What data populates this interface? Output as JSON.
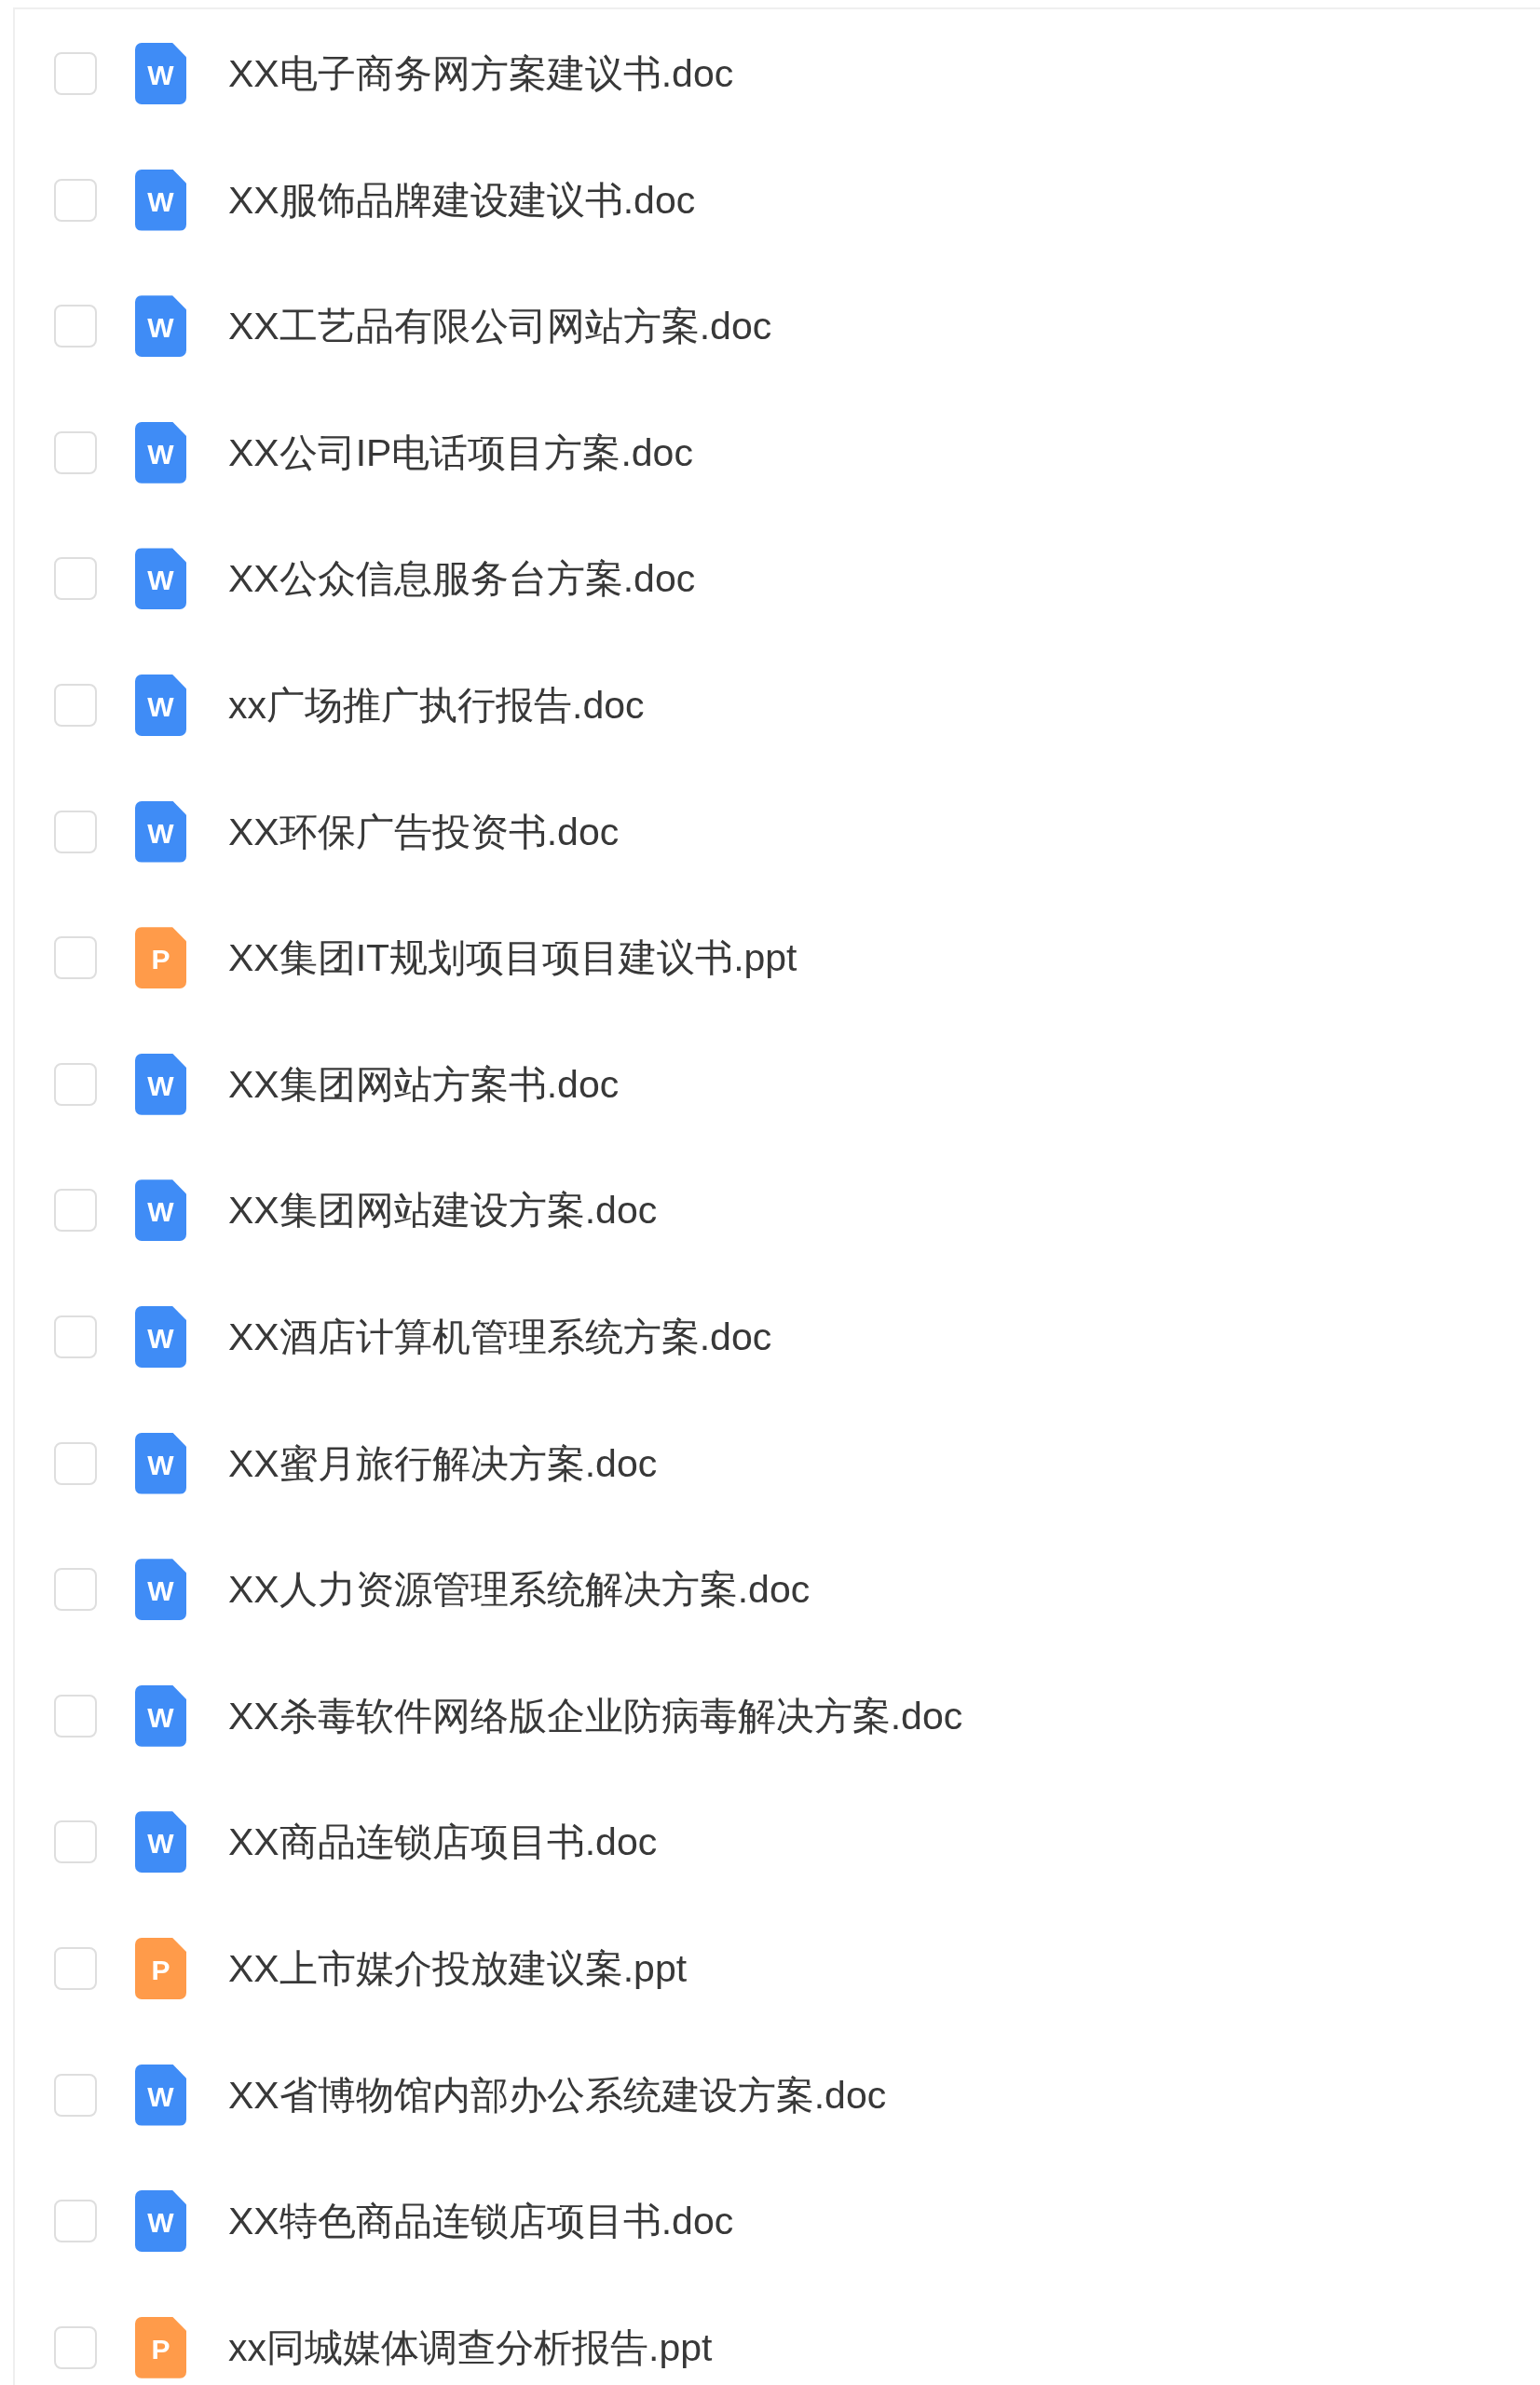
{
  "files": [
    {
      "name": "XX电子商务网方案建议书.doc",
      "kind": "word",
      "icon_label": "W",
      "checked": false
    },
    {
      "name": "XX服饰品牌建设建议书.doc",
      "kind": "word",
      "icon_label": "W",
      "checked": false
    },
    {
      "name": "XX工艺品有限公司网站方案.doc",
      "kind": "word",
      "icon_label": "W",
      "checked": false
    },
    {
      "name": "XX公司IP电话项目方案.doc",
      "kind": "word",
      "icon_label": "W",
      "checked": false
    },
    {
      "name": "XX公众信息服务台方案.doc",
      "kind": "word",
      "icon_label": "W",
      "checked": false
    },
    {
      "name": "xx广场推广执行报告.doc",
      "kind": "word",
      "icon_label": "W",
      "checked": false
    },
    {
      "name": "XX环保广告投资书.doc",
      "kind": "word",
      "icon_label": "W",
      "checked": false
    },
    {
      "name": "XX集团IT规划项目项目建议书.ppt",
      "kind": "powerpoint",
      "icon_label": "P",
      "checked": false
    },
    {
      "name": "XX集团网站方案书.doc",
      "kind": "word",
      "icon_label": "W",
      "checked": false
    },
    {
      "name": "XX集团网站建设方案.doc",
      "kind": "word",
      "icon_label": "W",
      "checked": false
    },
    {
      "name": "XX酒店计算机管理系统方案.doc",
      "kind": "word",
      "icon_label": "W",
      "checked": false
    },
    {
      "name": "XX蜜月旅行解决方案.doc",
      "kind": "word",
      "icon_label": "W",
      "checked": false
    },
    {
      "name": "XX人力资源管理系统解决方案.doc",
      "kind": "word",
      "icon_label": "W",
      "checked": false
    },
    {
      "name": "XX杀毒软件网络版企业防病毒解决方案.doc",
      "kind": "word",
      "icon_label": "W",
      "checked": false
    },
    {
      "name": "XX商品连锁店项目书.doc",
      "kind": "word",
      "icon_label": "W",
      "checked": false
    },
    {
      "name": "XX上市媒介投放建议案.ppt",
      "kind": "powerpoint",
      "icon_label": "P",
      "checked": false
    },
    {
      "name": "XX省博物馆内部办公系统建设方案.doc",
      "kind": "word",
      "icon_label": "W",
      "checked": false
    },
    {
      "name": "XX特色商品连锁店项目书.doc",
      "kind": "word",
      "icon_label": "W",
      "checked": false
    },
    {
      "name": "xx同城媒体调查分析报告.ppt",
      "kind": "powerpoint",
      "icon_label": "P",
      "checked": false
    }
  ]
}
